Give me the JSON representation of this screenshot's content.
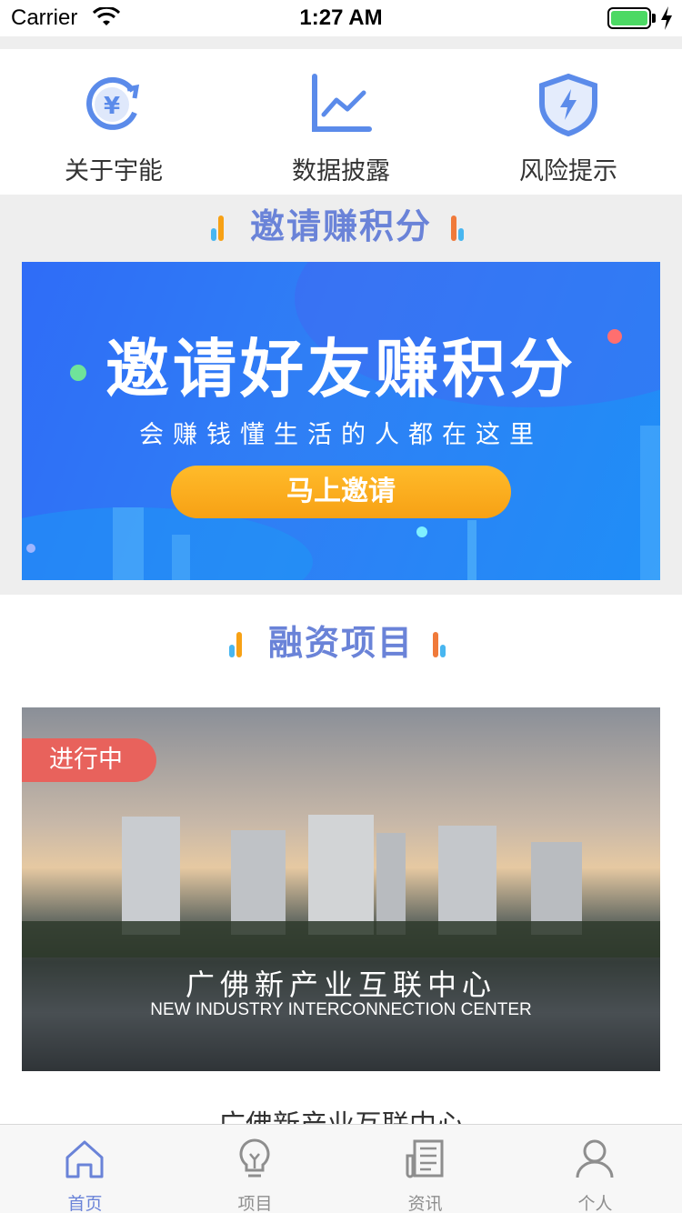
{
  "status_bar": {
    "carrier": "Carrier",
    "time": "1:27 AM"
  },
  "quick_menu": [
    {
      "label": "关于宇能",
      "icon": "yuan-refresh-icon"
    },
    {
      "label": "数据披露",
      "icon": "line-chart-icon"
    },
    {
      "label": "风险提示",
      "icon": "shield-bolt-icon"
    }
  ],
  "invite_section": {
    "title": "邀请赚积分",
    "banner": {
      "headline": "邀请好友赚积分",
      "subtitle": "会赚钱懂生活的人都在这里",
      "button_label": "马上邀请"
    }
  },
  "projects_section": {
    "title": "融资项目",
    "card": {
      "status": "进行中",
      "title_cn": "广佛新产业互联中心",
      "title_en": "NEW INDUSTRY INTERCONNECTION CENTER",
      "name": "广佛新产业互联中心"
    }
  },
  "tab_bar": [
    {
      "label": "首页",
      "icon": "home-icon",
      "active": true
    },
    {
      "label": "项目",
      "icon": "lightbulb-icon",
      "active": false
    },
    {
      "label": "资讯",
      "icon": "news-icon",
      "active": false
    },
    {
      "label": "个人",
      "icon": "person-icon",
      "active": false
    }
  ],
  "colors": {
    "accent": "#6a83d8",
    "tag": "#e8625c",
    "button": "#f7a115",
    "banner": "#2f7ff5"
  }
}
